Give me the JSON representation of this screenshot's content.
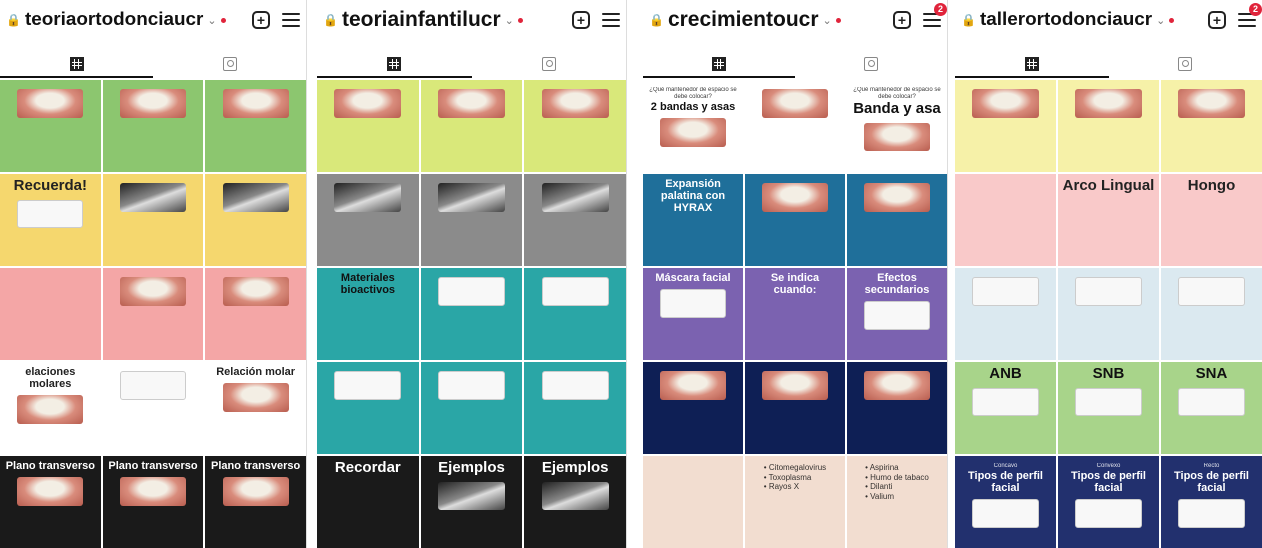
{
  "screens": [
    {
      "username": "teoriaortodonciaucr",
      "badge": "",
      "posts": [
        {
          "title": "",
          "text": "",
          "bg": "#8cc66f",
          "fg": "#222",
          "img": "tooth"
        },
        {
          "title": "",
          "text": "",
          "bg": "#8cc66f",
          "fg": "#222",
          "img": "tooth"
        },
        {
          "title": "",
          "text": "",
          "bg": "#8cc66f",
          "fg": "#222",
          "img": "tooth"
        },
        {
          "title": "Recuerda!",
          "text": "",
          "bg": "#f5d76e",
          "fg": "#222",
          "img": "white"
        },
        {
          "title": "",
          "text": "",
          "bg": "#f5d76e",
          "fg": "#222",
          "img": "xray"
        },
        {
          "title": "",
          "text": "",
          "bg": "#f5d76e",
          "fg": "#222",
          "img": "xray"
        },
        {
          "title": "",
          "text": "",
          "bg": "#f4a6a6",
          "fg": "#222",
          "img": ""
        },
        {
          "title": "",
          "text": "",
          "bg": "#f4a6a6",
          "fg": "#222",
          "img": "tooth"
        },
        {
          "title": "",
          "text": "",
          "bg": "#f4a6a6",
          "fg": "#222",
          "img": "tooth"
        },
        {
          "title": "elaciones molares",
          "text": "",
          "bg": "#ffffff",
          "fg": "#222",
          "img": "tooth"
        },
        {
          "title": "",
          "text": "",
          "bg": "#ffffff",
          "fg": "#222",
          "img": "white"
        },
        {
          "title": "Relación molar",
          "text": "",
          "bg": "#ffffff",
          "fg": "#222",
          "img": "tooth"
        },
        {
          "title": "Plano transverso",
          "text": "",
          "bg": "#1a1a1a",
          "fg": "#ffffff",
          "img": "tooth"
        },
        {
          "title": "Plano transverso",
          "text": "",
          "bg": "#1a1a1a",
          "fg": "#ffffff",
          "img": "tooth"
        },
        {
          "title": "Plano transverso",
          "text": "",
          "bg": "#1a1a1a",
          "fg": "#ffffff",
          "img": "tooth"
        }
      ]
    },
    {
      "username": "teoriainfantilucr",
      "badge": "",
      "posts": [
        {
          "title": "",
          "text": "",
          "bg": "#d9e87a",
          "fg": "#222",
          "img": "tooth"
        },
        {
          "title": "",
          "text": "",
          "bg": "#d9e87a",
          "fg": "#222",
          "img": "tooth"
        },
        {
          "title": "",
          "text": "",
          "bg": "#d9e87a",
          "fg": "#222",
          "img": "tooth"
        },
        {
          "title": "",
          "text": "",
          "bg": "#8b8b8b",
          "fg": "#ffffff",
          "img": "xray"
        },
        {
          "title": "",
          "text": "",
          "bg": "#8b8b8b",
          "fg": "#ffffff",
          "img": "xray"
        },
        {
          "title": "",
          "text": "",
          "bg": "#8b8b8b",
          "fg": "#ffffff",
          "img": "xray"
        },
        {
          "title": "Materiales bioactivos",
          "text": "",
          "bg": "#2aa6a6",
          "fg": "#111",
          "img": ""
        },
        {
          "title": "",
          "text": "",
          "bg": "#2aa6a6",
          "fg": "#111",
          "img": "white"
        },
        {
          "title": "",
          "text": "",
          "bg": "#2aa6a6",
          "fg": "#111",
          "img": "white"
        },
        {
          "title": "",
          "text": "",
          "bg": "#2aa6a6",
          "fg": "#111",
          "img": "white"
        },
        {
          "title": "",
          "text": "",
          "bg": "#2aa6a6",
          "fg": "#111",
          "img": "white"
        },
        {
          "title": "",
          "text": "",
          "bg": "#2aa6a6",
          "fg": "#111",
          "img": "white"
        },
        {
          "title": "Recordar",
          "text": "",
          "bg": "#1a1a1a",
          "fg": "#ffffff",
          "img": ""
        },
        {
          "title": "Ejemplos",
          "text": "",
          "bg": "#1a1a1a",
          "fg": "#ffffff",
          "img": "xray"
        },
        {
          "title": "Ejemplos",
          "text": "",
          "bg": "#1a1a1a",
          "fg": "#ffffff",
          "img": "xray"
        }
      ]
    },
    {
      "username": "crecimientoucr",
      "badge": "2",
      "posts": [
        {
          "title": "2 bandas y asas",
          "text": "¿Qué mantenedor de espacio se debe colocar?",
          "bg": "#ffffff",
          "fg": "#111",
          "img": "tooth"
        },
        {
          "title": "",
          "text": "",
          "bg": "#ffffff",
          "fg": "#111",
          "img": "tooth"
        },
        {
          "title": "Banda y asa",
          "text": "¿Qué mantenedor de espacio se debe colocar?",
          "bg": "#ffffff",
          "fg": "#111",
          "img": "tooth"
        },
        {
          "title": "Expansión palatina con HYRAX",
          "text": "",
          "bg": "#1f6f9a",
          "fg": "#ffffff",
          "img": ""
        },
        {
          "title": "",
          "text": "",
          "bg": "#1f6f9a",
          "fg": "#ffffff",
          "img": "tooth"
        },
        {
          "title": "",
          "text": "",
          "bg": "#1f6f9a",
          "fg": "#ffffff",
          "img": "tooth"
        },
        {
          "title": "Máscara facial",
          "text": "",
          "bg": "#7b62b0",
          "fg": "#ffffff",
          "img": "white"
        },
        {
          "title": "Se indica cuando:",
          "text": "",
          "bg": "#7b62b0",
          "fg": "#ffffff",
          "img": ""
        },
        {
          "title": "Efectos secundarios",
          "text": "",
          "bg": "#7b62b0",
          "fg": "#ffffff",
          "img": "white"
        },
        {
          "title": "",
          "text": "",
          "bg": "#0e1f55",
          "fg": "#ffffff",
          "img": "tooth"
        },
        {
          "title": "",
          "text": "",
          "bg": "#0e1f55",
          "fg": "#ffffff",
          "img": "tooth"
        },
        {
          "title": "",
          "text": "",
          "bg": "#0e1f55",
          "fg": "#ffffff",
          "img": "tooth"
        },
        {
          "title": "",
          "text": "",
          "bg": "#f2ddd0",
          "fg": "#111",
          "img": ""
        },
        {
          "title": "",
          "text": "• Citomegalovirus\n• Toxoplasma\n• Rayos X",
          "bg": "#f2ddd0",
          "fg": "#111",
          "img": ""
        },
        {
          "title": "",
          "text": "• Aspirina\n• Humo de tabaco\n• Dilanti\n• Valium",
          "bg": "#f2ddd0",
          "fg": "#111",
          "img": ""
        }
      ]
    },
    {
      "username": "tallerortodonciaucr",
      "badge": "2",
      "posts": [
        {
          "title": "",
          "text": "",
          "bg": "#f6f1a8",
          "fg": "#222",
          "img": "tooth"
        },
        {
          "title": "",
          "text": "",
          "bg": "#f6f1a8",
          "fg": "#222",
          "img": "tooth"
        },
        {
          "title": "",
          "text": "",
          "bg": "#f6f1a8",
          "fg": "#222",
          "img": "tooth"
        },
        {
          "title": "",
          "text": "",
          "bg": "#f9c9c9",
          "fg": "#222",
          "img": ""
        },
        {
          "title": "Arco Lingual",
          "text": "",
          "bg": "#f9c9c9",
          "fg": "#222",
          "img": ""
        },
        {
          "title": "Hongo",
          "text": "",
          "bg": "#f9c9c9",
          "fg": "#222",
          "img": ""
        },
        {
          "title": "",
          "text": "",
          "bg": "#dbe9f0",
          "fg": "#222",
          "img": "white"
        },
        {
          "title": "",
          "text": "",
          "bg": "#dbe9f0",
          "fg": "#222",
          "img": "white"
        },
        {
          "title": "",
          "text": "",
          "bg": "#dbe9f0",
          "fg": "#222",
          "img": "white"
        },
        {
          "title": "ANB",
          "text": "",
          "bg": "#a8d48a",
          "fg": "#111",
          "img": "white"
        },
        {
          "title": "SNB",
          "text": "",
          "bg": "#a8d48a",
          "fg": "#111",
          "img": "white"
        },
        {
          "title": "SNA",
          "text": "",
          "bg": "#a8d48a",
          "fg": "#111",
          "img": "white"
        },
        {
          "title": "Tipos de perfil facial",
          "text": "Concavo",
          "bg": "#22306e",
          "fg": "#ffffff",
          "img": "white"
        },
        {
          "title": "Tipos de perfil facial",
          "text": "Convexo",
          "bg": "#22306e",
          "fg": "#ffffff",
          "img": "white"
        },
        {
          "title": "Tipos de perfil facial",
          "text": "Recto",
          "bg": "#22306e",
          "fg": "#ffffff",
          "img": "white"
        }
      ]
    }
  ]
}
